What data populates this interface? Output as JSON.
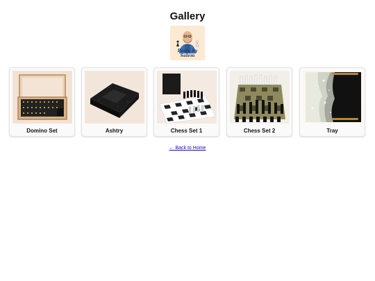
{
  "page": {
    "title": "Gallery",
    "logo_text": "Resin by Salem"
  },
  "gallery": {
    "items": [
      {
        "label": "Domino Set",
        "icon": "domino-set-image"
      },
      {
        "label": "Ashtry",
        "icon": "ashtray-image"
      },
      {
        "label": "Chess Set 1",
        "icon": "chess-set-image"
      },
      {
        "label": "Chess Set 2",
        "icon": "chess-set-image"
      },
      {
        "label": "Tray",
        "icon": "tray-image"
      }
    ]
  },
  "footer": {
    "back_link": "← Back to Home"
  }
}
